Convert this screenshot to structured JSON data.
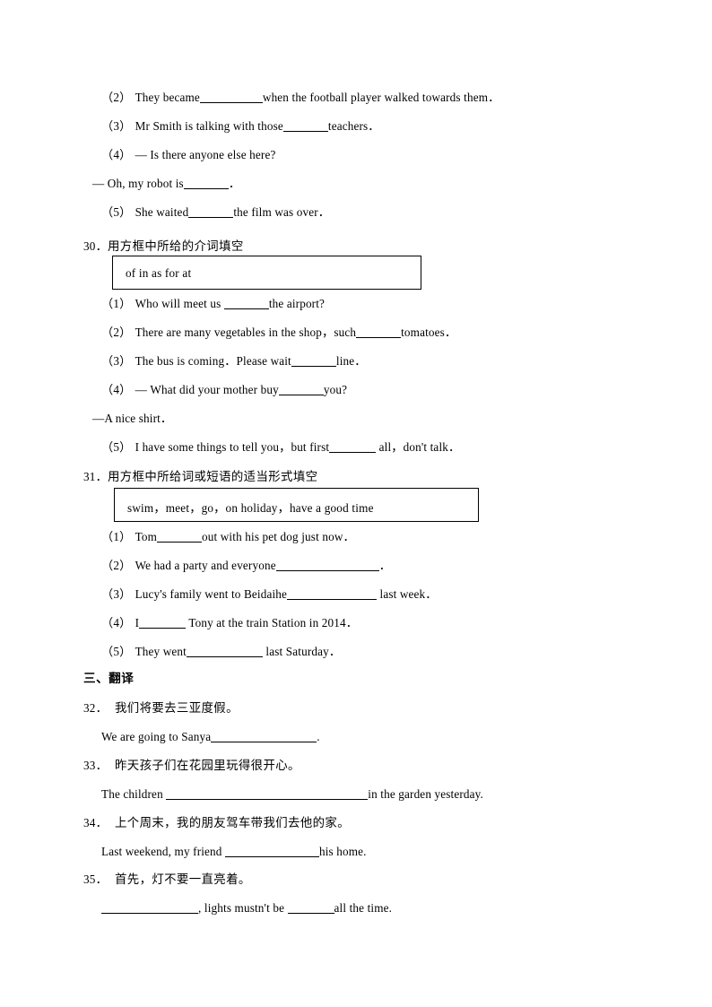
{
  "document": {
    "type": "english-exam-worksheet",
    "page_background": "#ffffff",
    "text_color": "#000000"
  },
  "q29_continued": {
    "items": [
      {
        "label": "（2）",
        "before": "They became",
        "blank_width": 70,
        "after": "when the football player walked towards them．"
      },
      {
        "label": "（3）",
        "before": "Mr Smith is talking with those",
        "blank_width": 50,
        "after": "teachers．"
      },
      {
        "label": "（4）",
        "before": "— Is there anyone else here?",
        "blank_width": 0,
        "after": ""
      },
      {
        "label": "",
        "before": "— Oh, my robot is",
        "blank_width": 50,
        "after": "．"
      },
      {
        "label": "（5）",
        "before": "She waited",
        "blank_width": 50,
        "after": "the film was over．"
      }
    ]
  },
  "q30": {
    "number": "30．",
    "prompt": "用方框中所给的介词填空",
    "wordbank": "of        in        as        for      at",
    "items": [
      {
        "label": "（1）",
        "before": "Who will meet us  ",
        "blank_width": 50,
        "after": "the airport?"
      },
      {
        "label": "（2）",
        "before": "There are many vegetables in the shop，such",
        "blank_width": 50,
        "after": "tomatoes．"
      },
      {
        "label": "（3）",
        "before": "The bus is coming．Please wait",
        "blank_width": 50,
        "after": "line．"
      },
      {
        "label": "（4）",
        "before": "— What did your mother buy",
        "blank_width": 50,
        "after": "you?"
      },
      {
        "label": "",
        "before": "—A nice shirt．",
        "blank_width": 0,
        "after": ""
      },
      {
        "label": "（5）",
        "before": "I have some things to tell you，but first",
        "blank_width": 52,
        "after": "  all，don't talk．"
      }
    ]
  },
  "q31": {
    "number": "31．",
    "prompt": "用方框中所给词或短语的适当形式填空",
    "wordbank": "swim，meet，go，on holiday，have a good time",
    "items": [
      {
        "label": "（1）",
        "before": "Tom",
        "blank_width": 50,
        "after": "out with his pet dog just now．"
      },
      {
        "label": "（2）",
        "before": "We had a party and everyone",
        "blank_width": 115,
        "after": "．"
      },
      {
        "label": "（3）",
        "before": "Lucy's family went to Beidaihe",
        "blank_width": 100,
        "after": "  last week．"
      },
      {
        "label": "（4）",
        "before": "I",
        "blank_width": 52,
        "after": "  Tony at the train Station in 2014．"
      },
      {
        "label": "（5）",
        "before": "They went",
        "blank_width": 85,
        "after": "  last Saturday．"
      }
    ]
  },
  "section3": {
    "heading": "三、翻译",
    "questions": [
      {
        "number": "32．",
        "chinese": "我们将要去三亚度假。",
        "answer_before": "We are going to Sanya",
        "blank_width": 118,
        "answer_after": "."
      },
      {
        "number": "33．",
        "chinese": "昨天孩子们在花园里玩得很开心。",
        "answer_before": "The children  ",
        "blank_width": 225,
        "answer_after": "in the garden yesterday."
      },
      {
        "number": "34．",
        "chinese": "上个周末，我的朋友驾车带我们去他的家。",
        "answer_before": "Last weekend, my friend  ",
        "blank_width": 105,
        "answer_after": "his home."
      },
      {
        "number": "35．",
        "chinese": "首先，灯不要一直亮着。",
        "answer_before": "",
        "blank_width": 108,
        "answer_mid": ", lights mustn't be  ",
        "blank2_width": 52,
        "answer_after": "all the time."
      }
    ]
  }
}
